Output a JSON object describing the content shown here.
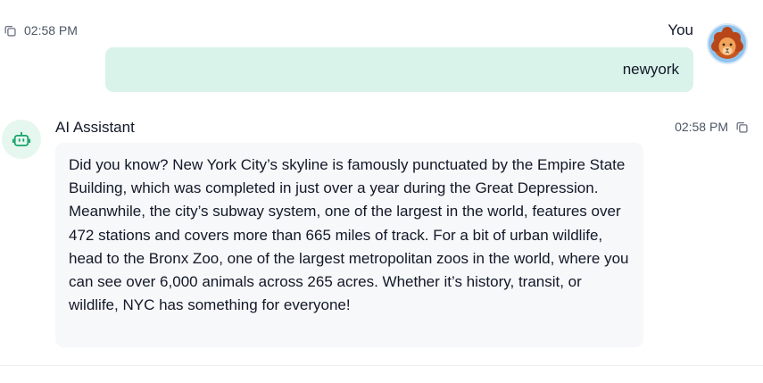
{
  "user_message": {
    "timestamp": "02:58 PM",
    "sender": "You",
    "text": "newyork",
    "avatar_icon": "lion-avatar",
    "copy_icon": "copy-icon",
    "bubble_color": "#d9f3ea"
  },
  "assistant_message": {
    "sender": "AI Assistant",
    "timestamp": "02:58 PM",
    "bot_icon": "robot-icon",
    "copy_icon": "copy-icon",
    "accent_color": "#1aa36b",
    "bubble_color": "#f7f8fa",
    "text": "Did you know? New York City’s skyline is famously punctuated by the Empire State Building, which was completed in just over a year during the Great Depression. Meanwhile, the city’s subway system, one of the largest in the world, features over 472 stations and covers more than 665 miles of track. For a bit of urban wildlife, head to the Bronx Zoo, one of the largest metropolitan zoos in the world, where you can see over 6,000 animals across 265 acres. Whether it’s history, transit, or wildlife, NYC has something for everyone!"
  }
}
